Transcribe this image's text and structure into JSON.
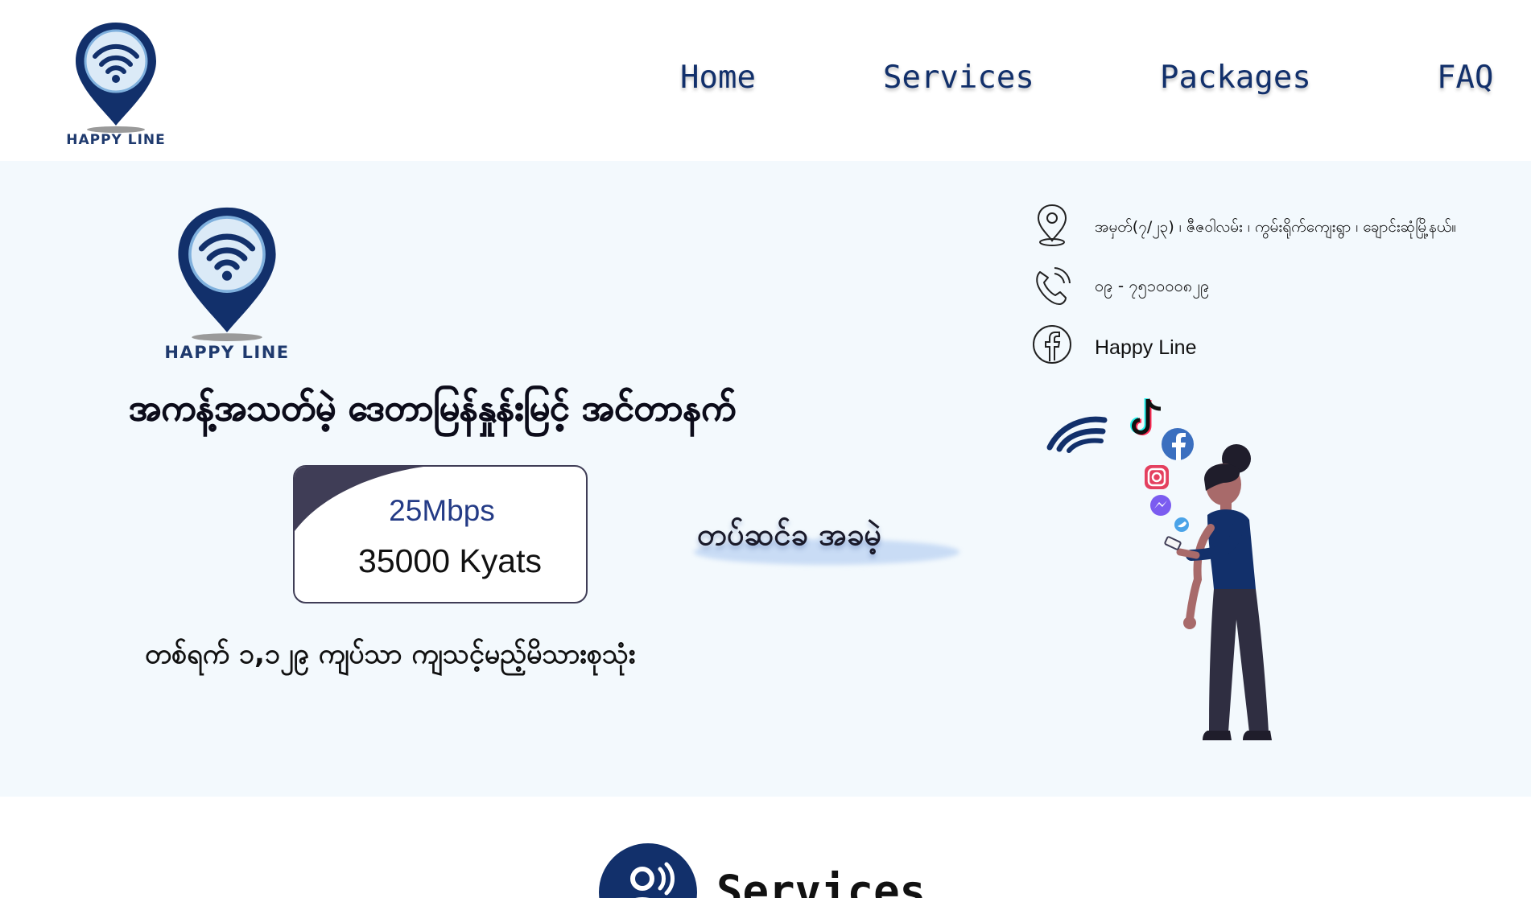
{
  "brand": {
    "name": "HAPPY LINE",
    "navy": "#12306b",
    "hero_bg": "#f3f9fd"
  },
  "nav": {
    "items": [
      {
        "label": "Home"
      },
      {
        "label": "Services"
      },
      {
        "label": "Packages"
      },
      {
        "label": "FAQ"
      }
    ]
  },
  "hero": {
    "logo_text": "HAPPY LINE",
    "headline": "အကန့်အသတ်မဲ့ ဒေတာမြန်နှုန်းမြင့် အင်တာနက်",
    "price": {
      "speed": "25Mbps",
      "amount": "35000 Kyats"
    },
    "free_install": "တပ်ဆင်ခ အခမဲ့",
    "subline": "တစ်ရက် ၁,၁၂၉ ကျပ်သာ ကျသင့်မည့်မိသားစုသုံး"
  },
  "contact": {
    "address": "အမှတ်(၇/၂၃) ၊ ဇီဇဝါလမ်း ၊ ကွမ်းရိုက်ကျေးရွာ ၊ ချောင်းဆုံမြို့နယ်။",
    "phone": "၀၉ - ၇၅၁၀၀၀၈၂၉",
    "facebook": "Happy Line",
    "icons": [
      "location-pin-icon",
      "phone-icon",
      "facebook-icon"
    ]
  },
  "services": {
    "title": "Services",
    "icon": "user-signal-icon"
  }
}
